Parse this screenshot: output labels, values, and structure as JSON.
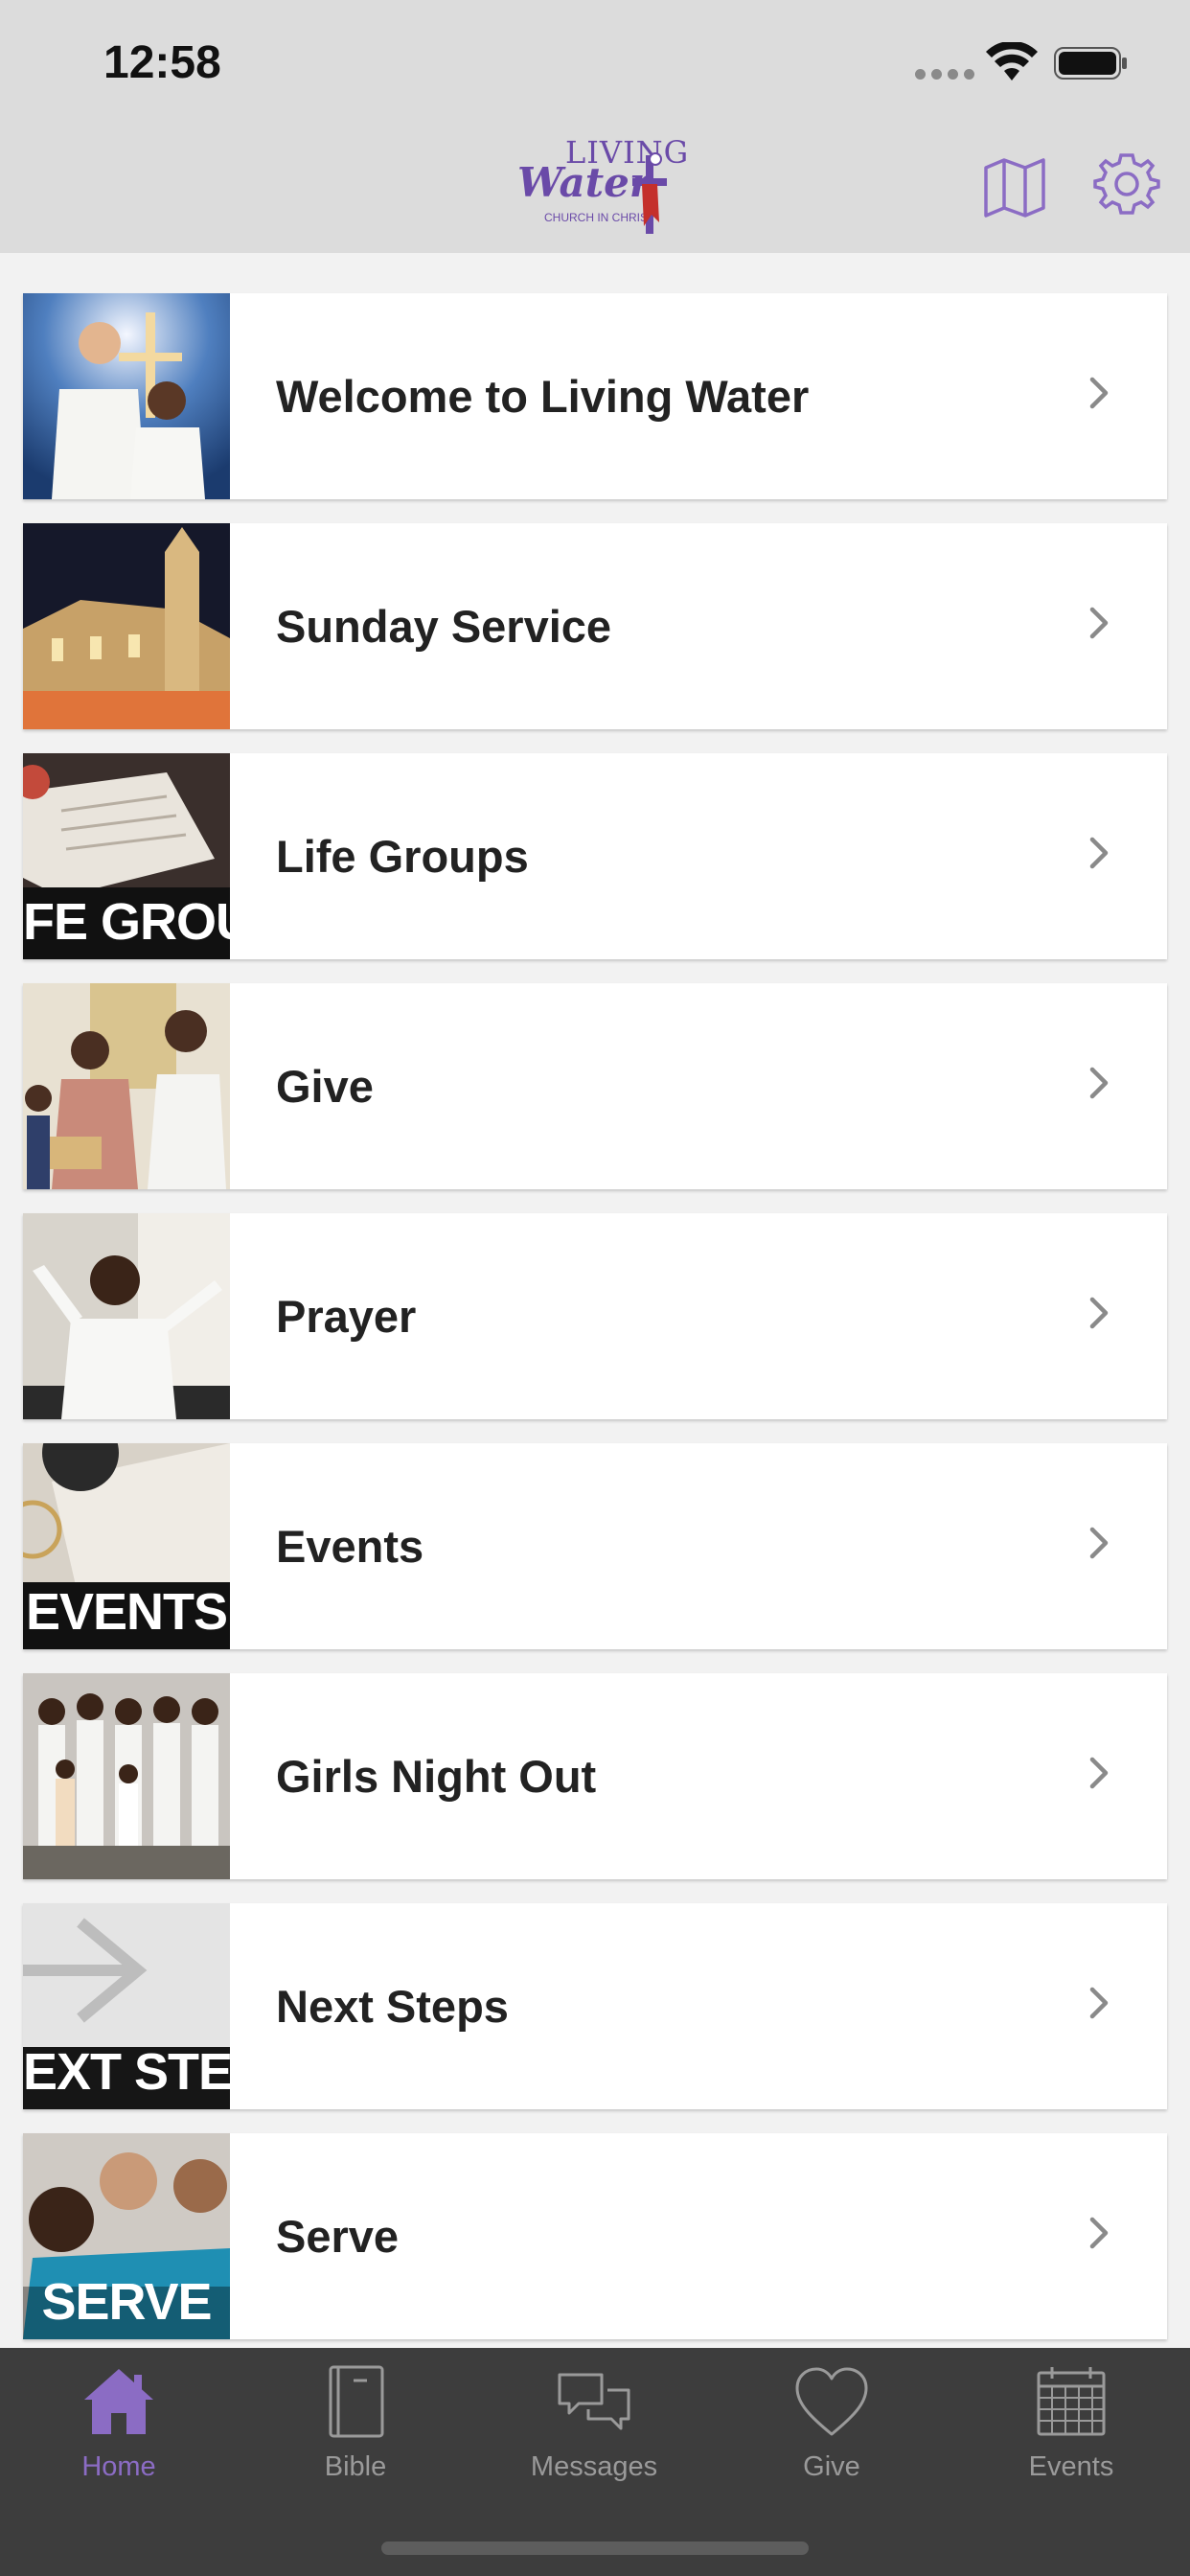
{
  "status_bar": {
    "time": "12:58"
  },
  "header": {
    "logo": {
      "line1": "LIVING",
      "line2": "Water",
      "line3": "CHURCH IN CHRIST"
    },
    "icons": [
      "map-icon",
      "gear-icon"
    ],
    "accent_color": "#8b6cc4"
  },
  "list": {
    "items": [
      {
        "label": "Welcome to Living Water",
        "thumb_text": ""
      },
      {
        "label": "Sunday Service",
        "thumb_text": ""
      },
      {
        "label": "Life Groups",
        "thumb_text": "FE GROU"
      },
      {
        "label": "Give",
        "thumb_text": ""
      },
      {
        "label": "Prayer",
        "thumb_text": ""
      },
      {
        "label": "Events",
        "thumb_text": "EVENTS"
      },
      {
        "label": "Girls Night Out",
        "thumb_text": ""
      },
      {
        "label": "Next Steps",
        "thumb_text": "EXT STEF"
      },
      {
        "label": "Serve",
        "thumb_text": "SERVE"
      }
    ]
  },
  "tabbar": {
    "tabs": [
      {
        "label": "Home",
        "icon": "home-icon",
        "active": true
      },
      {
        "label": "Bible",
        "icon": "bible-icon",
        "active": false
      },
      {
        "label": "Messages",
        "icon": "messages-icon",
        "active": false
      },
      {
        "label": "Give",
        "icon": "heart-icon",
        "active": false
      },
      {
        "label": "Events",
        "icon": "calendar-icon",
        "active": false
      }
    ]
  }
}
